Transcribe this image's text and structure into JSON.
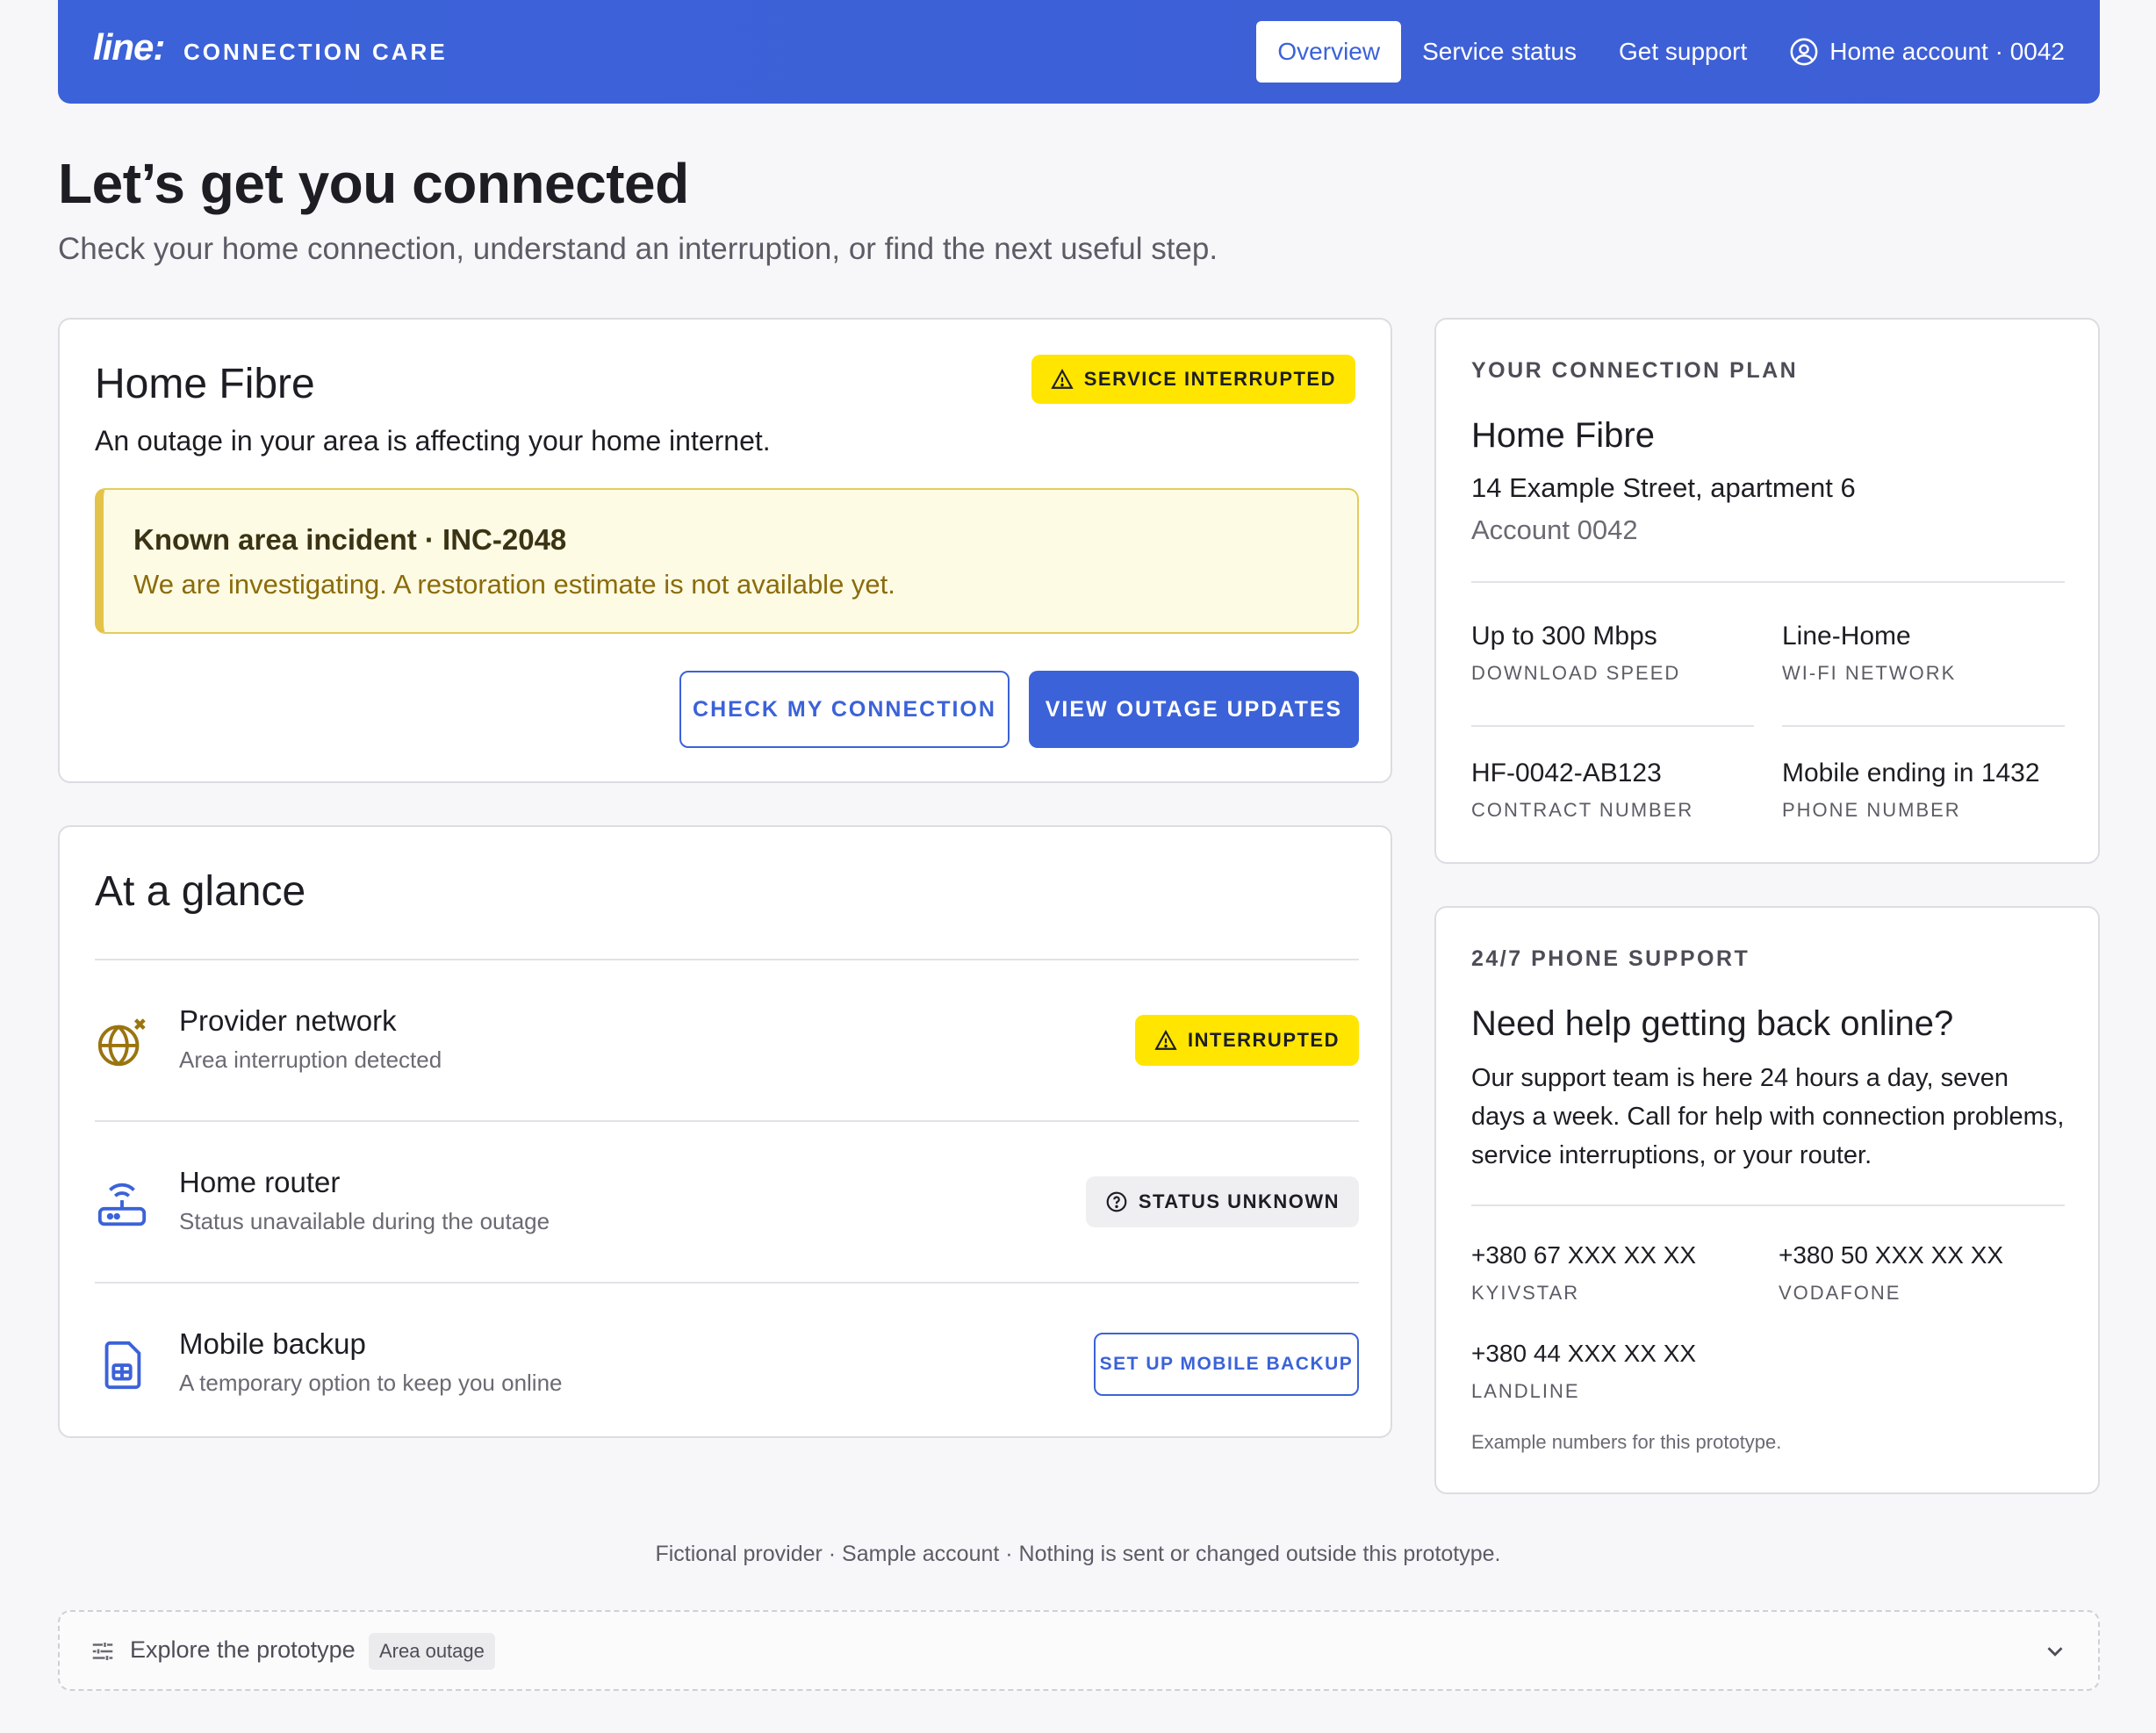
{
  "header": {
    "logo": "line:",
    "brand": "CONNECTION CARE",
    "nav": [
      "Overview",
      "Service status",
      "Get support"
    ],
    "account": "Home account · 0042"
  },
  "page": {
    "title": "Let’s get you connected",
    "subtitle": "Check your home connection, understand an interruption, or find the next useful step."
  },
  "service": {
    "title": "Home Fibre",
    "badge": "SERVICE INTERRUPTED",
    "description": "An outage in your area is affecting your home internet.",
    "incident_title": "Known area incident · INC-2048",
    "incident_detail": "We are investigating. A restoration estimate is not available yet.",
    "check_button": "CHECK MY CONNECTION",
    "updates_button": "VIEW OUTAGE UPDATES"
  },
  "glance": {
    "title": "At a glance",
    "rows": [
      {
        "title": "Provider network",
        "subtitle": "Area interruption detected",
        "status": "INTERRUPTED",
        "icon": "globe-x-icon"
      },
      {
        "title": "Home router",
        "subtitle": "Status unavailable during the outage",
        "status": "STATUS UNKNOWN",
        "icon": "router-icon"
      },
      {
        "title": "Mobile backup",
        "subtitle": "A temporary option to keep you online",
        "action": "SET UP MOBILE BACKUP",
        "icon": "sim-card-icon"
      }
    ]
  },
  "plan": {
    "eyebrow": "YOUR CONNECTION PLAN",
    "name": "Home Fibre",
    "address": "14 Example Street, apartment 6",
    "account": "Account 0042",
    "facts": [
      {
        "value": "Up to 300 Mbps",
        "label": "DOWNLOAD SPEED"
      },
      {
        "value": "Line-Home",
        "label": "WI-FI NETWORK"
      },
      {
        "value": "HF-0042-AB123",
        "label": "CONTRACT NUMBER"
      },
      {
        "value": "Mobile ending in 1432",
        "label": "PHONE NUMBER"
      }
    ]
  },
  "support": {
    "eyebrow": "24/7 PHONE SUPPORT",
    "question": "Need help getting back online?",
    "text": "Our support team is here 24 hours a day, seven days a week. Call for help with connection problems, service interruptions, or your router.",
    "phones": [
      {
        "number": "+380 67 XXX XX XX",
        "label": "KYIVSTAR"
      },
      {
        "number": "+380 50 XXX XX XX",
        "label": "VODAFONE"
      },
      {
        "number": "+380 44 XXX XX XX",
        "label": "LANDLINE"
      }
    ],
    "note": "Example numbers for this prototype."
  },
  "footer": "Fictional provider · Sample account · Nothing is sent or changed outside this prototype.",
  "explore": {
    "label": "Explore the prototype",
    "tag": "Area outage"
  },
  "colors": {
    "brand": "#3b62d8",
    "warning": "#ffe500",
    "incident_bg": "#fefbe4",
    "icon_amber": "#8b6c0c"
  }
}
